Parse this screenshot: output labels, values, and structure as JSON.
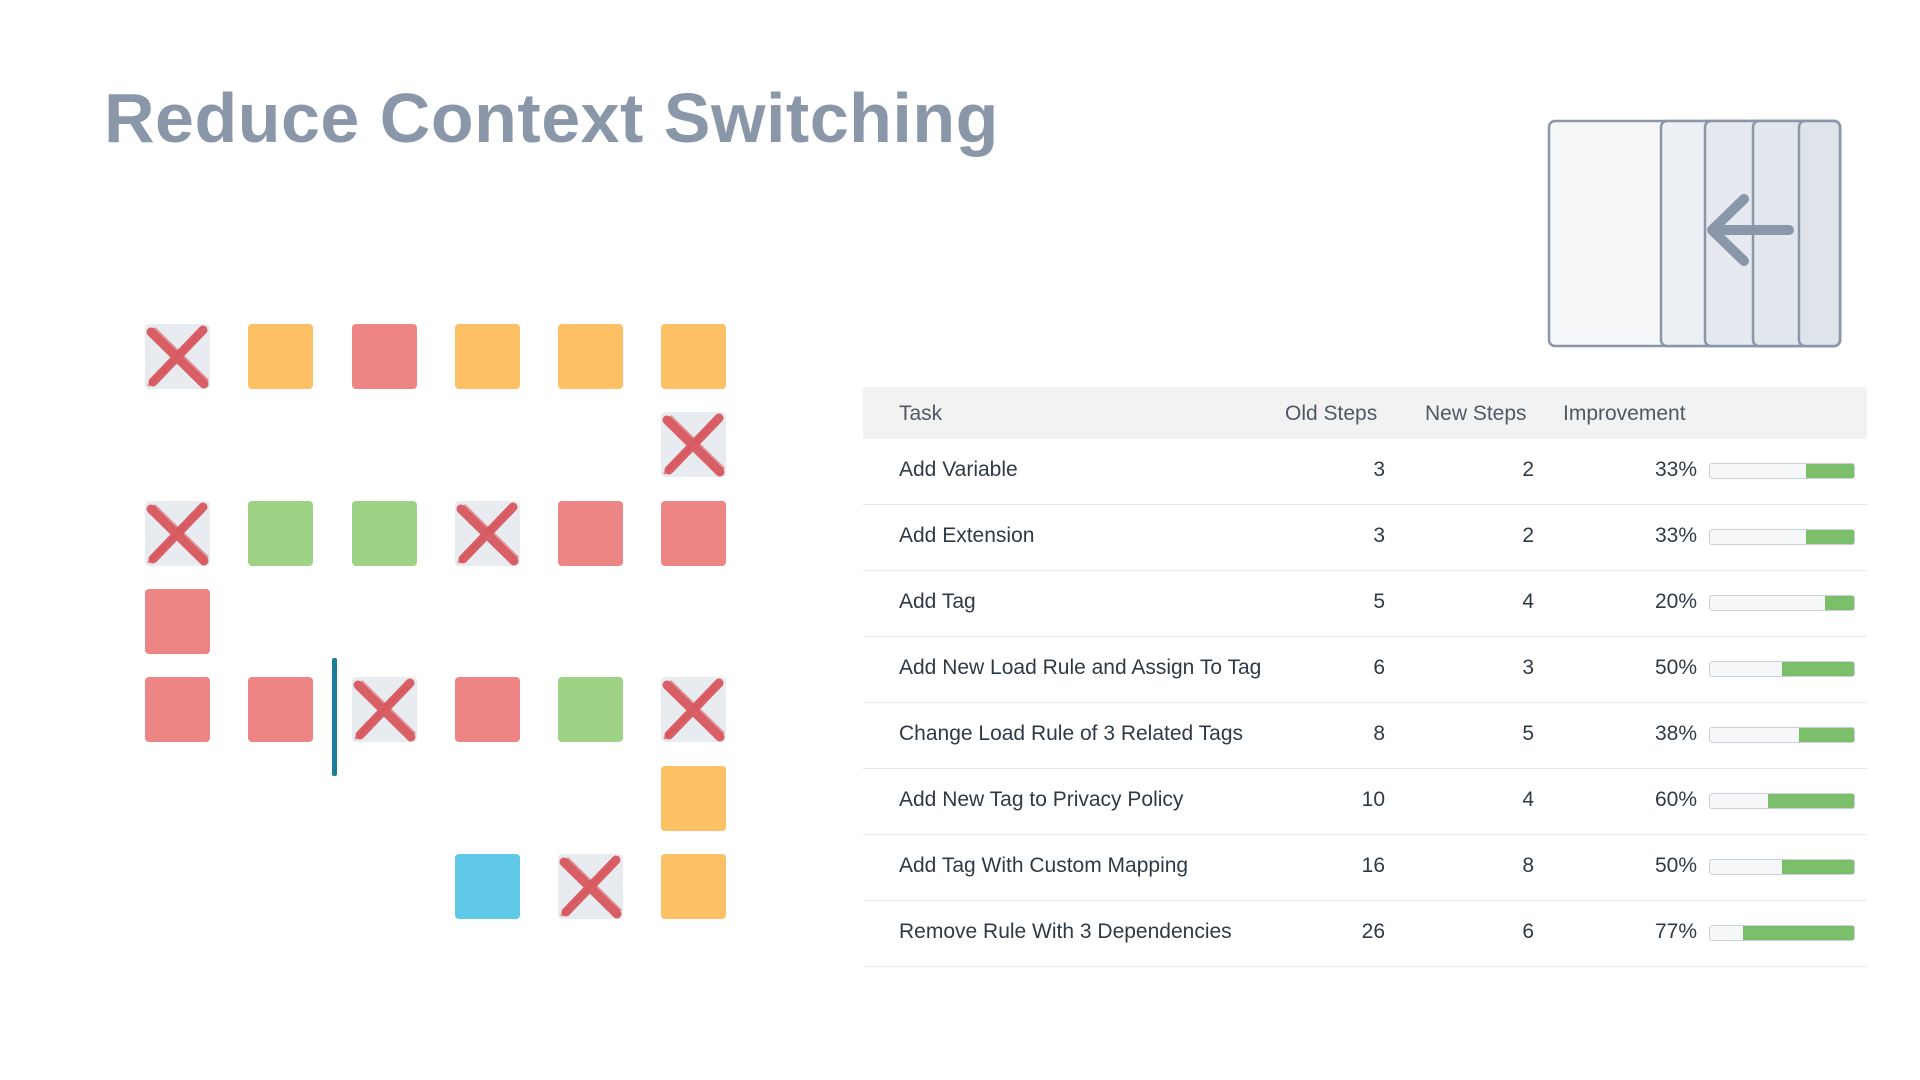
{
  "title": "Reduce Context Switching",
  "colors": {
    "orange": "#fdc064",
    "red": "#ee8585",
    "green": "#9ed386",
    "blue": "#60c9e8",
    "removed": "#e8ebef",
    "cross": "#d8545b",
    "progress": "#7bbf6a"
  },
  "tiles": [
    {
      "row": 0,
      "col": 0,
      "color": "removed"
    },
    {
      "row": 0,
      "col": 1,
      "color": "orange"
    },
    {
      "row": 0,
      "col": 2,
      "color": "red"
    },
    {
      "row": 0,
      "col": 3,
      "color": "orange"
    },
    {
      "row": 0,
      "col": 4,
      "color": "orange"
    },
    {
      "row": 0,
      "col": 5,
      "color": "orange"
    },
    {
      "row": 1,
      "col": 5,
      "color": "removed"
    },
    {
      "row": 2,
      "col": 0,
      "color": "removed"
    },
    {
      "row": 2,
      "col": 1,
      "color": "green"
    },
    {
      "row": 2,
      "col": 2,
      "color": "green"
    },
    {
      "row": 2,
      "col": 3,
      "color": "removed"
    },
    {
      "row": 2,
      "col": 4,
      "color": "red"
    },
    {
      "row": 2,
      "col": 5,
      "color": "red"
    },
    {
      "row": 3,
      "col": 0,
      "color": "red"
    },
    {
      "row": 4,
      "col": 0,
      "color": "red"
    },
    {
      "row": 4,
      "col": 1,
      "color": "red"
    },
    {
      "row": 4,
      "col": 2,
      "color": "removed"
    },
    {
      "row": 4,
      "col": 3,
      "color": "red"
    },
    {
      "row": 4,
      "col": 4,
      "color": "green"
    },
    {
      "row": 4,
      "col": 5,
      "color": "removed"
    },
    {
      "row": 5,
      "col": 5,
      "color": "orange"
    },
    {
      "row": 6,
      "col": 3,
      "color": "blue"
    },
    {
      "row": 6,
      "col": 4,
      "color": "removed"
    },
    {
      "row": 6,
      "col": 5,
      "color": "orange"
    }
  ],
  "panel_icon": "panel-collapse-left-arrow-icon",
  "table": {
    "headers": {
      "task": "Task",
      "old_steps": "Old Steps",
      "new_steps": "New Steps",
      "improvement": "Improvement"
    },
    "rows": [
      {
        "task": "Add Variable",
        "old_steps": "3",
        "new_steps": "2",
        "improvement": "33%",
        "fraction": 0.33
      },
      {
        "task": "Add Extension",
        "old_steps": "3",
        "new_steps": "2",
        "improvement": "33%",
        "fraction": 0.33
      },
      {
        "task": "Add Tag",
        "old_steps": "5",
        "new_steps": "4",
        "improvement": "20%",
        "fraction": 0.2
      },
      {
        "task": "Add New Load Rule and Assign To Tag",
        "old_steps": "6",
        "new_steps": "3",
        "improvement": "50%",
        "fraction": 0.5
      },
      {
        "task": "Change Load Rule of 3 Related Tags",
        "old_steps": "8",
        "new_steps": "5",
        "improvement": "38%",
        "fraction": 0.38
      },
      {
        "task": "Add New Tag to Privacy Policy",
        "old_steps": "10",
        "new_steps": "4",
        "improvement": "60%",
        "fraction": 0.6
      },
      {
        "task": "Add Tag With Custom Mapping",
        "old_steps": "16",
        "new_steps": "8",
        "improvement": "50%",
        "fraction": 0.5
      },
      {
        "task": "Remove Rule With 3 Dependencies",
        "old_steps": "26",
        "new_steps": "6",
        "improvement": "77%",
        "fraction": 0.77
      }
    ]
  }
}
